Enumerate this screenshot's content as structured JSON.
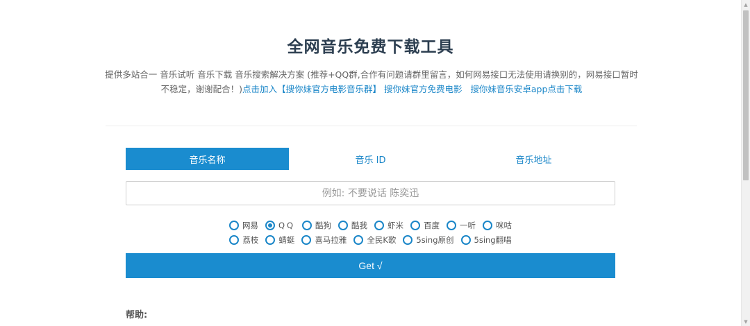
{
  "header": {
    "title": "全网音乐免费下载工具",
    "desc_text": "提供多站合一 音乐试听 音乐下载 音乐搜索解决方案 (推荐+QQ群,合作有问题请群里留言，如何网易接口无法使用请换别的，网易接口暂时不稳定，谢谢配合！)",
    "link_join_group": "点击加入【搜你妹官方电影音乐群】",
    "link_movies": "搜你妹官方免费电影",
    "link_android_app": "搜你妹音乐安卓app点击下载"
  },
  "tabs": [
    {
      "label": "音乐名称",
      "active": true
    },
    {
      "label": "音乐 ID",
      "active": false
    },
    {
      "label": "音乐地址",
      "active": false
    }
  ],
  "search": {
    "placeholder": "例如: 不要说话 陈奕迅",
    "value": ""
  },
  "sources": {
    "row1": [
      {
        "label": "网易",
        "checked": false
      },
      {
        "label": "QQ",
        "checked": true
      },
      {
        "label": "酷狗",
        "checked": false
      },
      {
        "label": "酷我",
        "checked": false
      },
      {
        "label": "虾米",
        "checked": false
      },
      {
        "label": "百度",
        "checked": false
      },
      {
        "label": "一听",
        "checked": false
      },
      {
        "label": "咪咕",
        "checked": false
      }
    ],
    "row2": [
      {
        "label": "荔枝",
        "checked": false
      },
      {
        "label": "蜻蜓",
        "checked": false
      },
      {
        "label": "喜马拉雅",
        "checked": false
      },
      {
        "label": "全民K歌",
        "checked": false
      },
      {
        "label": "5sing原创",
        "checked": false
      },
      {
        "label": "5sing翻唱",
        "checked": false
      }
    ]
  },
  "actions": {
    "get_label": "Get √"
  },
  "help": {
    "label": "帮助:"
  },
  "colors": {
    "accent": "#1a8ccf",
    "link": "#1a86c8",
    "title": "#2c3e50"
  },
  "icons": {
    "scroll_up": "triangle-up-icon",
    "scroll_down": "triangle-down-icon",
    "radio": "radio-circle-icon"
  }
}
